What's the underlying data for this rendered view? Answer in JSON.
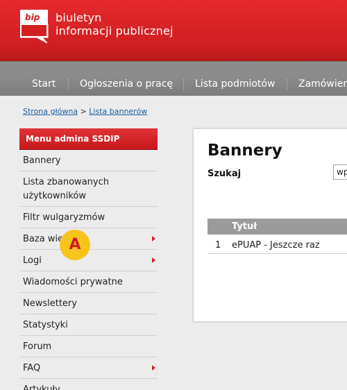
{
  "header": {
    "logo_text": "bip",
    "line1": "biuletyn",
    "line2": "informacji publicznej"
  },
  "nav": {
    "items": [
      "Start",
      "Ogłoszenia o pracę",
      "Lista podmiotów",
      "Zamówien"
    ]
  },
  "breadcrumb": {
    "home": "Strona główna",
    "separator": ">",
    "current": "Lista bannerów"
  },
  "sidebar": {
    "title": "Menu admina SSDIP",
    "items": [
      {
        "label": "Bannery"
      },
      {
        "label": "Lista zbanowanych użytkowników"
      },
      {
        "label": "Filtr wulgaryzmów"
      },
      {
        "label": "Baza wie"
      },
      {
        "label": "Logi"
      },
      {
        "label": "Wiadomości prywatne"
      },
      {
        "label": "Newslettery"
      },
      {
        "label": "Statystyki"
      },
      {
        "label": "Forum"
      },
      {
        "label": "FAQ"
      },
      {
        "label": "Artykuły"
      }
    ]
  },
  "marker": {
    "label": "A"
  },
  "panel": {
    "title": "Bannery",
    "search_label": "Szukaj",
    "search_value": "wp",
    "table": {
      "header_title": "Tytuł",
      "rows": [
        {
          "num": "1",
          "title": "ePUAP - Jeszcze raz"
        }
      ]
    }
  },
  "colors": {
    "brand_red": "#d21f22",
    "nav_gray": "#8a8a8a",
    "marker_yellow": "#f7c41b",
    "link_blue": "#1b5c98"
  }
}
